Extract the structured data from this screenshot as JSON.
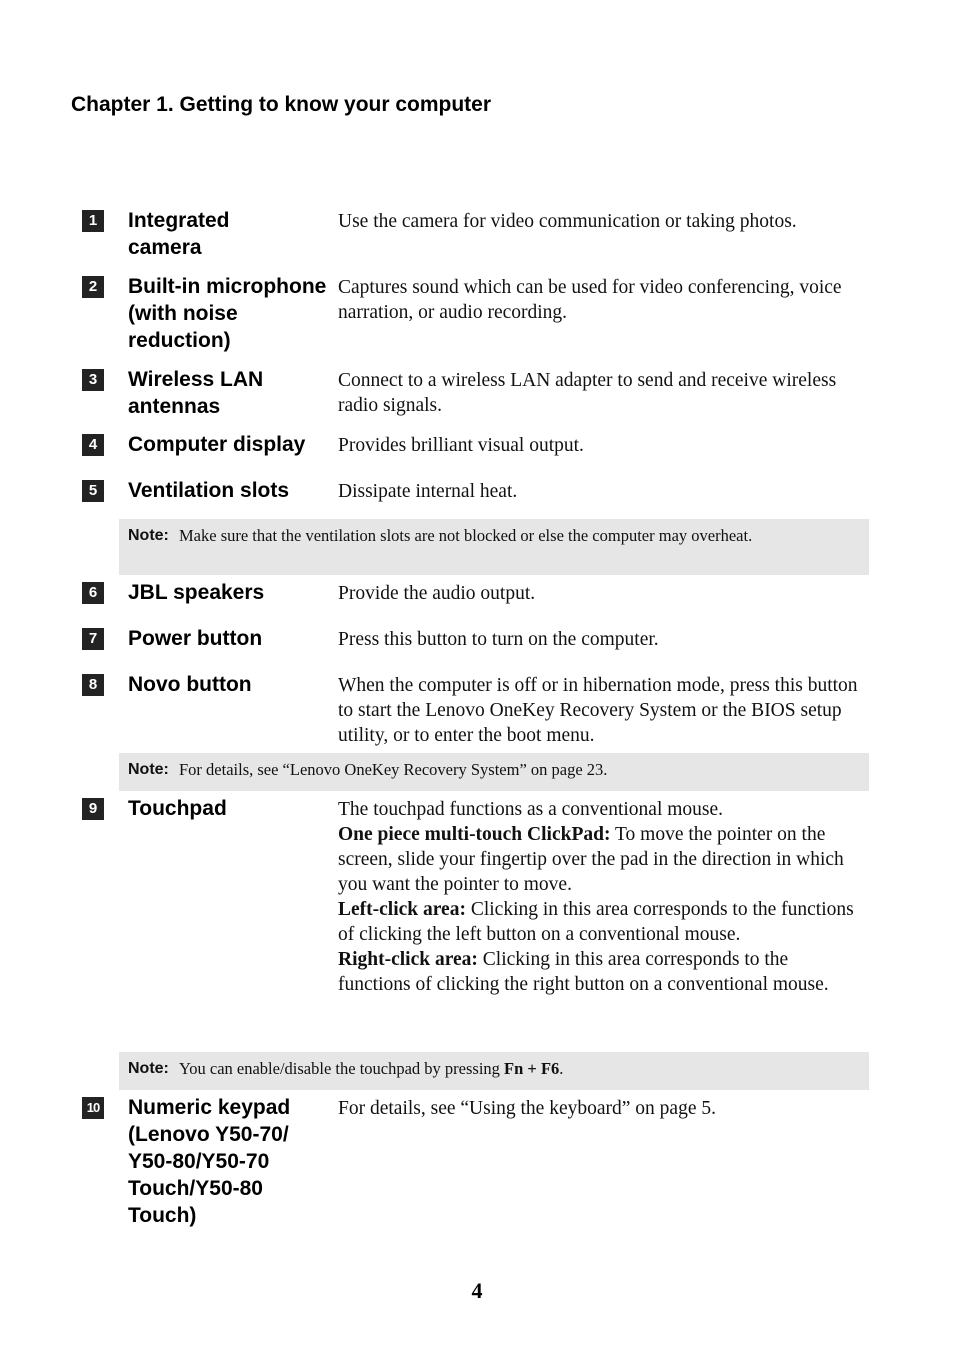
{
  "chapter_title": "Chapter 1. Getting to know your computer",
  "items": [
    {
      "number": "1",
      "term": "Integrated camera",
      "description": "Use the camera for video communication or taking photos."
    },
    {
      "number": "2",
      "term": "Built-in microphone (with noise reduction)",
      "description": "Captures sound which can be used for video conferencing, voice narration, or audio recording."
    },
    {
      "number": "3",
      "term": "Wireless LAN antennas",
      "description": "Connect to a wireless LAN adapter to send and receive wireless radio signals."
    },
    {
      "number": "4",
      "term": "Computer display",
      "description": "Provides brilliant visual output."
    },
    {
      "number": "5",
      "term": "Ventilation slots",
      "description": "Dissipate internal heat."
    },
    {
      "number": "6",
      "term": "JBL speakers",
      "description": "Provide the audio output."
    },
    {
      "number": "7",
      "term": "Power button",
      "description": "Press this button to turn on the computer."
    },
    {
      "number": "8",
      "term": "Novo button",
      "description": "When the computer is off or in hibernation mode, press this button to start the Lenovo OneKey Recovery System or the BIOS setup utility, or to enter the boot menu."
    },
    {
      "number": "9",
      "term": "Touchpad",
      "description": "The touchpad functions as a conventional mouse.",
      "sub": [
        {
          "label": "One piece multi-touch ClickPad:",
          "text": " To move the pointer on the screen, slide your fingertip over the pad in the direction in which you want the pointer to move."
        },
        {
          "label": "Left-click area:",
          "text": " Clicking in this area corresponds to the functions of clicking the left button on a conventional mouse."
        },
        {
          "label": "Right-click area:",
          "text": " Clicking in this area corresponds to the functions of clicking the right button on a conventional mouse."
        }
      ]
    },
    {
      "number": "10",
      "term": "Numeric keypad (Lenovo Y50-70/ Y50-80/Y50-70 Touch/Y50-80 Touch)",
      "description": "For details, see “Using the keyboard” on page 5."
    }
  ],
  "notes": [
    {
      "label": "Note:",
      "text": "Make sure that the ventilation slots are not blocked or else the computer may overheat."
    },
    {
      "label": "Note:",
      "text": "For details, see “Lenovo OneKey Recovery System” on page 23."
    },
    {
      "label": "Note:",
      "text": "You can enable/disable the touchpad by pressing ",
      "key": "Fn + F6",
      "after": "."
    }
  ],
  "page_number": "4",
  "colors": {
    "badge": "#232323",
    "note_background": "#e6e6e6"
  }
}
